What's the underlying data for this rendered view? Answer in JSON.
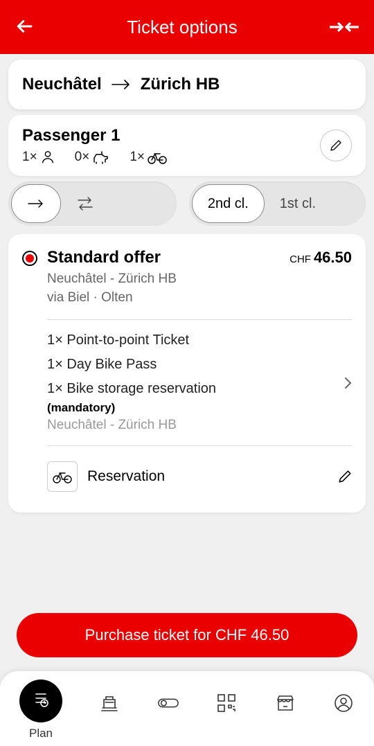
{
  "header": {
    "title": "Ticket options"
  },
  "route": {
    "from": "Neuchâtel",
    "to": "Zürich HB"
  },
  "passenger": {
    "title": "Passenger 1",
    "person_count": "1×",
    "dog_count": "0×",
    "bike_count": "1×"
  },
  "direction": {
    "one_way_label": "→",
    "round_trip_label": "⇄"
  },
  "class": {
    "second": "2nd cl.",
    "first": "1st cl."
  },
  "offer": {
    "title": "Standard offer",
    "currency": "CHF",
    "price": "46.50",
    "route": "Neuchâtel - Zürich HB",
    "via": "via Biel · Olten",
    "items": [
      "1× Point-to-point Ticket",
      "1× Day Bike Pass",
      "1× Bike storage reservation"
    ],
    "mandatory": "(mandatory)",
    "mandatory_route": "Neuchâtel - Zürich HB",
    "reservation_label": "Reservation"
  },
  "purchase": {
    "label": "Purchase ticket for CHF 46.50"
  },
  "nav": {
    "plan": "Plan"
  }
}
